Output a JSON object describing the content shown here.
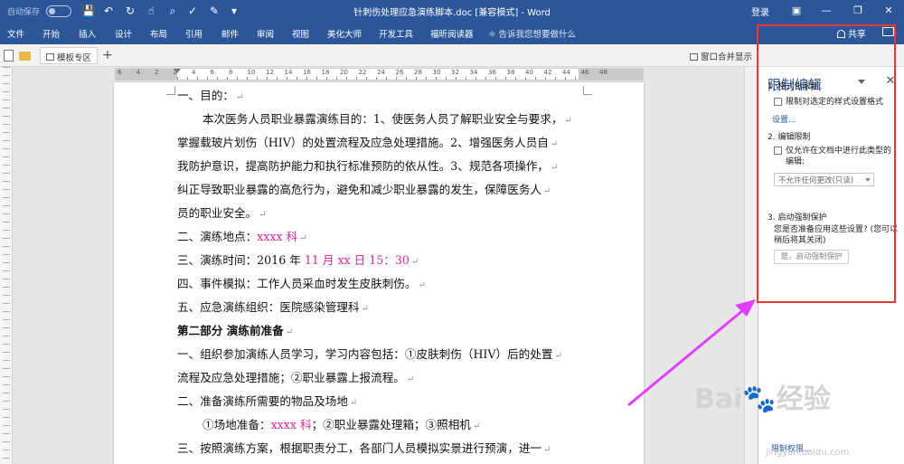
{
  "titlebar": {
    "autosave_label": "自动保存",
    "autosave_state": "关",
    "title": "针刺伤处理应急演练脚本.doc [兼容模式] - Word",
    "login": "登录",
    "icons": [
      "save-icon",
      "undo-icon",
      "redo-icon",
      "touch-icon",
      "print-preview-icon",
      "spellcheck-icon",
      "format-icon",
      "more-icon"
    ]
  },
  "menu": [
    "文件",
    "开始",
    "插入",
    "设计",
    "布局",
    "引用",
    "邮件",
    "审阅",
    "视图",
    "美化大师",
    "开发工具",
    "福昕阅读器"
  ],
  "tell_me": "告诉我您想要做什么",
  "share": "共享",
  "tabs": {
    "template_zone": "模板专区",
    "merge_windows": "窗口合并显示"
  },
  "ruler": {
    "numbers": [
      "6",
      "4",
      "2",
      "2",
      "4",
      "6",
      "8",
      "10",
      "12",
      "14",
      "16",
      "18",
      "20",
      "22",
      "24",
      "26",
      "28",
      "30",
      "32",
      "34",
      "36",
      "38",
      "40",
      "42",
      "44",
      "46",
      "48"
    ]
  },
  "document": {
    "lines": [
      {
        "indent": 0,
        "parts": [
          {
            "t": "一、目的：",
            "c": ""
          }
        ]
      },
      {
        "indent": 28,
        "parts": [
          {
            "t": "本次医务人员职业暴露演练目的：1、使医务人员了解职业安全与要求，",
            "c": ""
          }
        ]
      },
      {
        "indent": 0,
        "parts": [
          {
            "t": "掌握载玻片划伤（HIV）的处置流程及应急处理措施。2、增强医务人员自",
            "c": ""
          }
        ]
      },
      {
        "indent": 0,
        "parts": [
          {
            "t": "我防护意识，提高防护能力和执行标准预防的依从性。3、规范各项操作，",
            "c": ""
          }
        ]
      },
      {
        "indent": 0,
        "parts": [
          {
            "t": "纠正导致职业暴露的高危行为，避免和减少职业暴露的发生，保障医务人",
            "c": ""
          }
        ]
      },
      {
        "indent": 0,
        "parts": [
          {
            "t": "员的职业安全。",
            "c": ""
          }
        ]
      },
      {
        "indent": 0,
        "parts": [
          {
            "t": "二、演练地点：",
            "c": ""
          },
          {
            "t": "xxxx 科",
            "c": "pink"
          }
        ]
      },
      {
        "indent": 0,
        "parts": [
          {
            "t": "三、演练时间：2016 年 ",
            "c": ""
          },
          {
            "t": "11 月 xx 日  15：30",
            "c": "pink"
          }
        ]
      },
      {
        "indent": 0,
        "parts": [
          {
            "t": "四、事件模拟：工作人员采血时发生皮肤刺伤。",
            "c": ""
          }
        ]
      },
      {
        "indent": 0,
        "parts": [
          {
            "t": "五、应急演练组织：医院感染管理科",
            "c": ""
          }
        ]
      },
      {
        "indent": 0,
        "parts": [
          {
            "t": "第二部分        演练前准备",
            "c": "bold"
          }
        ]
      },
      {
        "indent": 0,
        "parts": [
          {
            "t": "一、组织参加演练人员学习，学习内容包括：①皮肤刺伤（HIV）后的处置",
            "c": ""
          }
        ]
      },
      {
        "indent": 0,
        "parts": [
          {
            "t": "流程及应急处理措施；②职业暴露上报流程。",
            "c": ""
          }
        ]
      },
      {
        "indent": 0,
        "parts": [
          {
            "t": "二、准备演练所需要的物品及场地",
            "c": ""
          }
        ]
      },
      {
        "indent": 28,
        "parts": [
          {
            "t": "①场地准备：",
            "c": ""
          },
          {
            "t": "xxxx 科",
            "c": "pink"
          },
          {
            "t": "；②职业暴露处理箱；③照相机",
            "c": ""
          }
        ]
      },
      {
        "indent": 0,
        "parts": [
          {
            "t": "三、按照演练方案，根据职责分工，各部门人员模拟实景进行预演，进一",
            "c": ""
          }
        ]
      }
    ]
  },
  "pane": {
    "title": "限制编辑",
    "section1": "1. 格式化限制",
    "checkbox1": "限制对选定的样式设置格式",
    "settings_link": "设置...",
    "section2": "2. 编辑限制",
    "checkbox2_line1": "仅允许在文档中进行此类型的",
    "checkbox2_line2": "编辑:",
    "select_value": "不允许任何更改(只读)",
    "section3": "3. 启动强制保护",
    "section3_text": "您是否准备应用这些设置? (您可以稍后将其关闭)",
    "start_button": "是，启动强制保护",
    "bottom_link": "限制权限..."
  },
  "annotation": {
    "box_color": "#e53935",
    "arrow_color": "#e040fb"
  },
  "watermark": {
    "brand": "Bai du 经验",
    "url": "jingyan.baidu.com"
  },
  "colors": {
    "brand_blue": "#2b579a",
    "highlight_pink": "#d6269b"
  }
}
